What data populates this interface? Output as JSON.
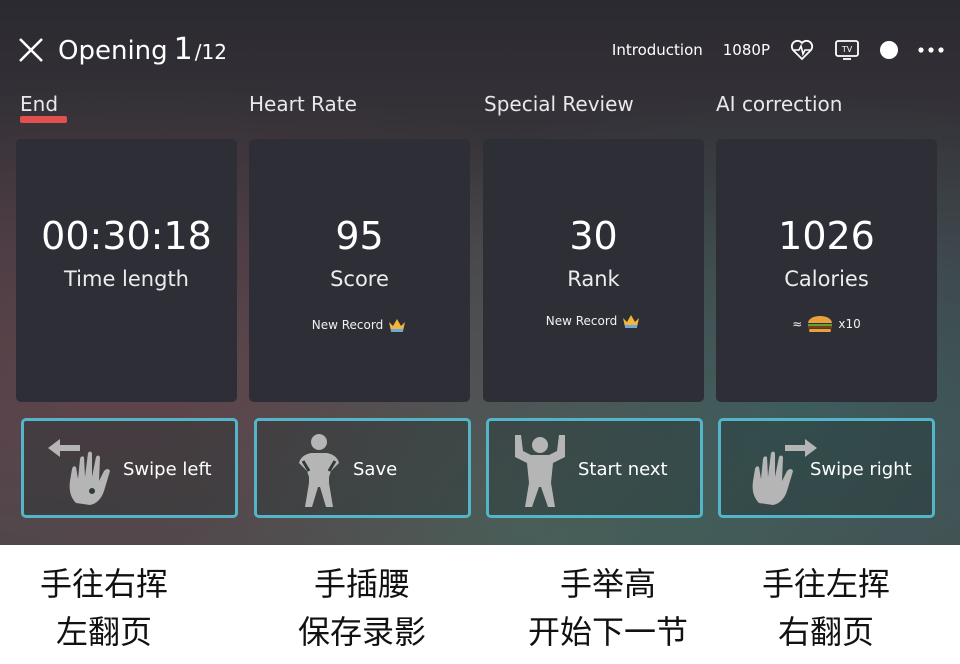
{
  "header": {
    "title": "Opening",
    "page_current": "1",
    "page_total": "/12",
    "introduction_label": "Introduction",
    "resolution_label": "1080P",
    "icons": [
      "close-icon",
      "heart-rate-icon",
      "tv-cast-icon",
      "record-toggle-icon",
      "more-icon"
    ]
  },
  "tabs": [
    {
      "label": "End",
      "active": true
    },
    {
      "label": "Heart Rate"
    },
    {
      "label": "Special Review"
    },
    {
      "label": "AI correction"
    }
  ],
  "cards": [
    {
      "value": "00:30:18",
      "label": "Time length",
      "extra": ""
    },
    {
      "value": "95",
      "label": "Score",
      "extra": "New Record",
      "extra_icon": "crown-icon"
    },
    {
      "value": "30",
      "label": "Rank",
      "extra": "New Record",
      "extra_icon": "crown-icon"
    },
    {
      "value": "1026",
      "label": "Calories",
      "extra_prefix": "≈",
      "extra": "x10",
      "extra_icon": "burger-icon"
    }
  ],
  "gestures": [
    {
      "label": "Swipe left",
      "icon": "hand-swipe-left-icon"
    },
    {
      "label": "Save",
      "icon": "hands-on-hips-icon"
    },
    {
      "label": "Start next",
      "icon": "arms-raised-icon"
    },
    {
      "label": "Swipe right",
      "icon": "hand-swipe-right-icon"
    }
  ],
  "captions": [
    {
      "line1": "手往右挥",
      "line2": "左翻页"
    },
    {
      "line1": "手插腰",
      "line2": "保存录影"
    },
    {
      "line1": "手举高",
      "line2": "开始下一节"
    },
    {
      "line1": "手往左挥",
      "line2": "右翻页"
    }
  ],
  "colors": {
    "accent_underline": "#e0504e",
    "gesture_border": "#55b5c8",
    "card_bg": "#2e2e37"
  }
}
